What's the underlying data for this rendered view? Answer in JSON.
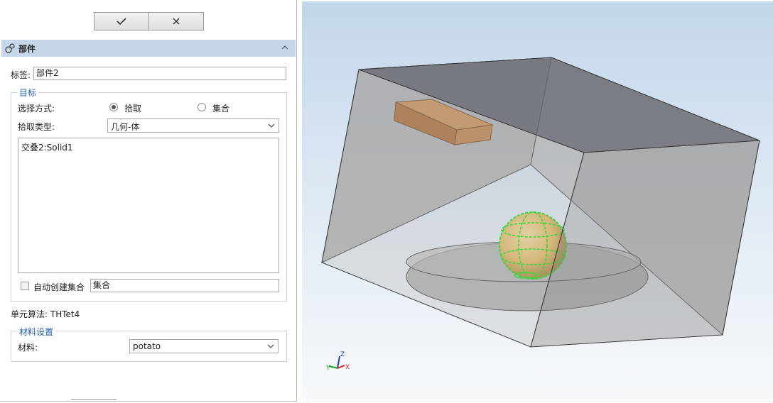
{
  "dialog": {
    "ok_icon": "check-icon",
    "cancel_icon": "close-icon",
    "section_title": "部件",
    "section_icon": "part-icon",
    "label_caption": "标签:",
    "label_value": "部件2",
    "target_group_title": "目标",
    "select_mode_caption": "选择方式:",
    "radio_pick": "拾取",
    "radio_set": "集合",
    "selected_mode": "拾取",
    "pick_type_caption": "拾取类型:",
    "pick_type_value": "几何-体",
    "pick_list": [
      "交叠2:Solid1"
    ],
    "auto_create_set_caption": "自动创建集合",
    "auto_create_set_checked": false,
    "set_name_value": "集合",
    "element_algorithm": "单元算法: THTet4",
    "material_group_title": "材料设置",
    "material_caption": "材料:",
    "material_value": "potato"
  },
  "viewport": {
    "axes": {
      "z": "Z",
      "x": "X",
      "y": "Y"
    },
    "colors": {
      "box_fill": "#8e8e8e",
      "block_fill": "#b46f2e",
      "sphere_fill": "#e8c265",
      "selection_highlight": "#00e000",
      "axis_x": "#e02020",
      "axis_y": "#20a020",
      "axis_z": "#2040c0"
    }
  }
}
